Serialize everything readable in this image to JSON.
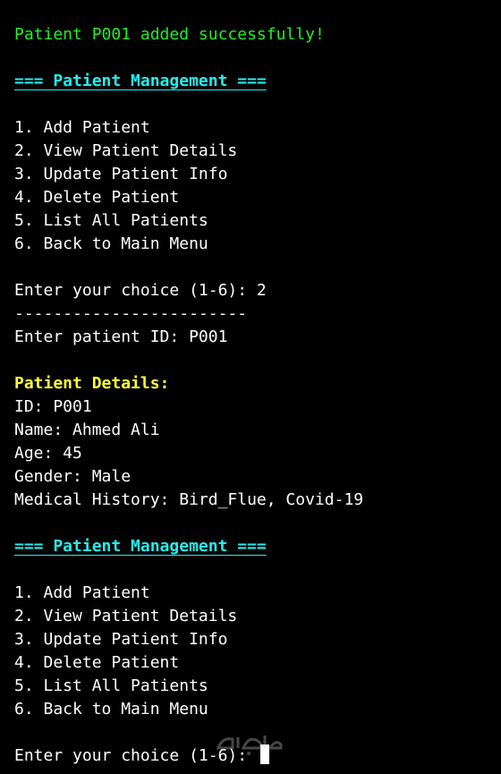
{
  "success_message": "Patient P001 added successfully!",
  "menu_header": "=== Patient Management ===",
  "menu_items": [
    "1. Add Patient",
    "2. View Patient Details",
    "3. Update Patient Info",
    "4. Delete Patient",
    "5. List All Patients",
    "6. Back to Main Menu"
  ],
  "choice_prompt_1": "Enter your choice (1-6): 2",
  "separator": "------------------------",
  "id_prompt": "Enter patient ID: P001",
  "details": {
    "title": "Patient Details:",
    "id": "ID: P001",
    "name": "Name: Ahmed Ali",
    "age": "Age: 45",
    "gender": "Gender: Male",
    "history": "Medical History: Bird_Flue, Covid-19"
  },
  "choice_prompt_2": "Enter your choice (1-6): ",
  "colors": {
    "background": "#000000",
    "text": "#ffffff",
    "success": "#22ee22",
    "header": "#22eeee",
    "details_title": "#ffff33"
  },
  "watermark_logo": "mostaql"
}
